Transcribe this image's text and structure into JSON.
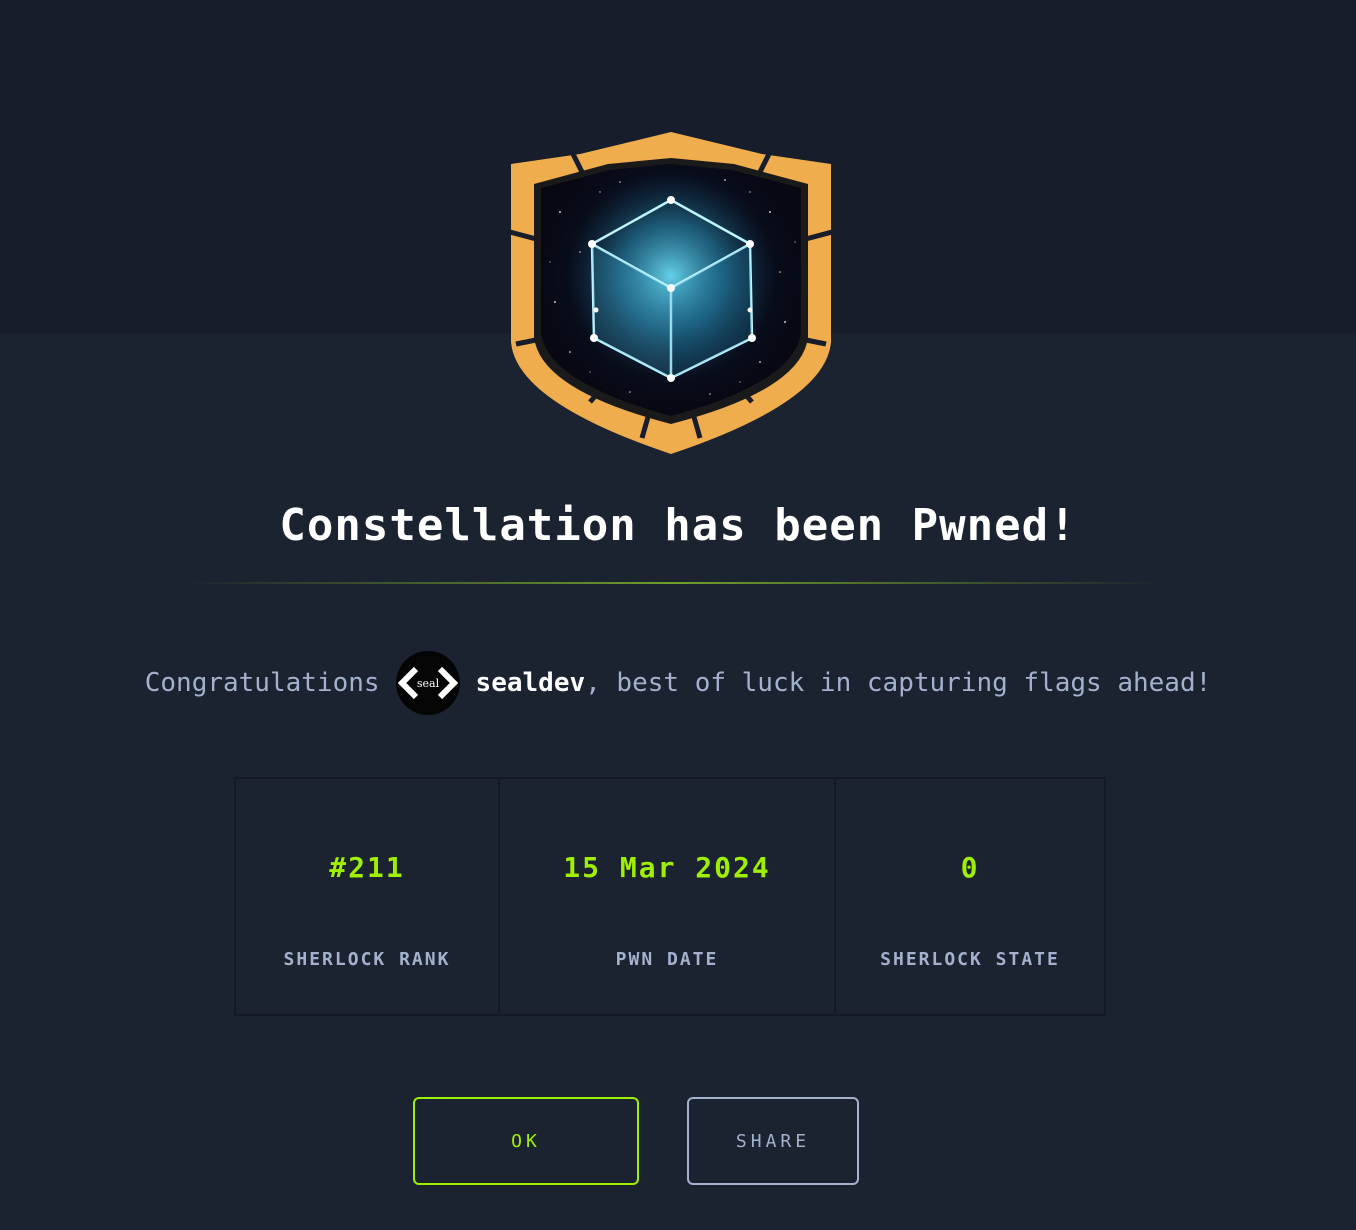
{
  "modal": {
    "title": "Constellation has been Pwned!",
    "badge_icon": "constellation-cube-shield-icon",
    "congrats_prefix": "Congratulations",
    "username": "sealdev",
    "congrats_suffix": ", best of luck in capturing flags ahead!",
    "avatar_text": "seal"
  },
  "stats": [
    {
      "value": "#211",
      "label": "SHERLOCK RANK"
    },
    {
      "value": "15 Mar 2024",
      "label": "PWN DATE"
    },
    {
      "value": "0",
      "label": "SHERLOCK STATE"
    }
  ],
  "buttons": {
    "ok_label": "OK",
    "share_label": "SHARE"
  },
  "colors": {
    "accent_green": "#9fef00",
    "muted_text": "#a4b1cd",
    "badge_orange": "#f0ad4e",
    "background": "#1b2230"
  }
}
